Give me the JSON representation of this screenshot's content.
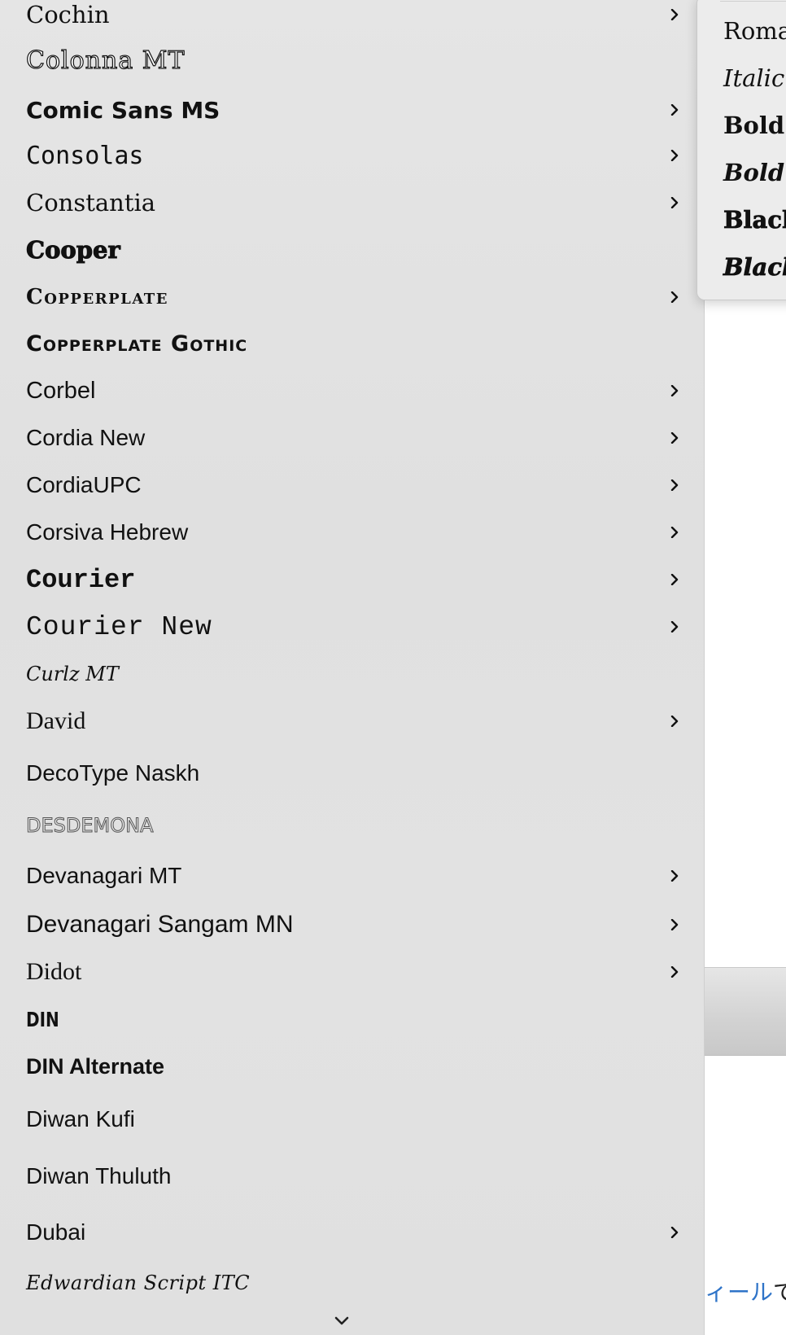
{
  "font_menu": {
    "items": [
      {
        "label": "Cochin",
        "has_submenu": true
      },
      {
        "label": "Colonna MT",
        "has_submenu": false
      },
      {
        "label": "Comic Sans MS",
        "has_submenu": true
      },
      {
        "label": "Consolas",
        "has_submenu": true
      },
      {
        "label": "Constantia",
        "has_submenu": true
      },
      {
        "label": "Cooper",
        "has_submenu": false
      },
      {
        "label": "Copperplate",
        "has_submenu": true
      },
      {
        "label": "Copperplate Gothic",
        "has_submenu": false
      },
      {
        "label": "Corbel",
        "has_submenu": true
      },
      {
        "label": "Cordia New",
        "has_submenu": true
      },
      {
        "label": "CordiaUPC",
        "has_submenu": true
      },
      {
        "label": "Corsiva Hebrew",
        "has_submenu": true
      },
      {
        "label": "Courier",
        "has_submenu": true
      },
      {
        "label": "Courier New",
        "has_submenu": true
      },
      {
        "label": "Curlz MT",
        "has_submenu": false
      },
      {
        "label": "David",
        "has_submenu": true
      },
      {
        "label": "DecoType Naskh",
        "has_submenu": false
      },
      {
        "label": "Desdemona",
        "has_submenu": false
      },
      {
        "label": "Devanagari MT",
        "has_submenu": true
      },
      {
        "label": "Devanagari Sangam MN",
        "has_submenu": true
      },
      {
        "label": "Didot",
        "has_submenu": true
      },
      {
        "label": "DIN",
        "has_submenu": false
      },
      {
        "label": "DIN Alternate",
        "has_submenu": false
      },
      {
        "label": "Diwan Kufi",
        "has_submenu": false
      },
      {
        "label": "Diwan Thuluth",
        "has_submenu": false
      },
      {
        "label": "Dubai",
        "has_submenu": true
      },
      {
        "label": "Edwardian Script ITC",
        "has_submenu": false
      }
    ],
    "scroll_indicator_icon": "chevron-down-icon"
  },
  "style_submenu": {
    "items": [
      "Roman",
      "Italic",
      "Bold",
      "Bold Italic",
      "Black",
      "Black Italic"
    ]
  },
  "background": {
    "link_text": "ィール",
    "link_suffix": "で"
  },
  "colors": {
    "menu_bg": "#e2e2e2",
    "text": "#111111",
    "link": "#2f74c8"
  }
}
